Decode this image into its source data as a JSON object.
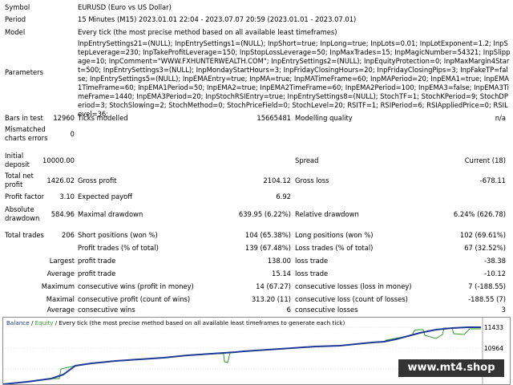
{
  "symbol": {
    "label": "Symbol",
    "value": "EURUSD (Euro vs US Dollar)"
  },
  "period": {
    "label": "Period",
    "value": "15 Minutes (M15) 2023.01.01 22:04 - 2023.07.07 20:59 (2023.01.01 - 2023.07.01)"
  },
  "model": {
    "label": "Model",
    "value": "Every tick (the most precise method based on all available least timeframes)"
  },
  "parameters": {
    "label": "Parameters",
    "value": "InpEntrySettings21=(NULL); InpEntrySettings1=(NULL); InpShort=true; InpLong=true; InpLots=0.01; InpLotExponent=1.2; InpStepLeverage=230; InpTakeProfitLeverage=150; InpStopLossLeverage=50; InpMaxTrades=15; InpMagicNumber=54321; InpSlippage=10; InpComment=\"WWW.FXHUNTERWEALTH.COM\"; InpEntrySettings2=(NULL); InpEquityProtection=0; InpMaxMargin4Start=500; InpEntrySettings3=(NULL); InpMondayStartHours=3; InpFridayClosingHours=20; InpFridayClosingPips=3; InpFakeTP=false; InpEntrySettings5=(NULL); InpEMAEntry=true; InpMA=true; InpMATimeFrame=60; InpMAPeriod=20; InpEMA1=true; InpEMA1TimeFrame=60; InpEMA1Period=50; InpEMA2=true; InpEMA2TimeFrame=60; InpEMA2Period=100; InpEMA3=false; InpEMA3TimeFrame=1440; InpEMA3Period=20; InpStochRSIEntry=true; InpEntrySettings8=(NULL); StochTF=1; StochKPeriod=9; StochDPeriod=3; StochSlowing=2; StochMethod=0; StochPriceField=0; StochLevel=20; RSITF=1; RSIPeriod=6; RSIAppliedPrice=0; RSILevel=36;"
  },
  "bars": {
    "label": "Bars in test",
    "value": "12960",
    "ticks_label": "Ticks modelled",
    "ticks_value": "15665481",
    "quality_label": "Modelling quality",
    "quality_value": "n/a"
  },
  "mismatched": {
    "label1": "Mismatched",
    "label2": "charts errors",
    "value": "0"
  },
  "deposit": {
    "label1": "Initial",
    "label2": "deposit",
    "value": "10000.00",
    "spread_label": "Spread",
    "spread_value": "Current (18)"
  },
  "net": {
    "label1": "Total net",
    "label2": "profit",
    "value": "1426.02",
    "gp_label": "Gross profit",
    "gp_value": "2104.12",
    "gl_label": "Gross loss",
    "gl_value": "-678.11"
  },
  "pf": {
    "label": "Profit factor",
    "value": "3.10",
    "ep_label": "Expected payoff",
    "ep_value": "6.92"
  },
  "dd": {
    "label1": "Absolute",
    "label2": "drawdown",
    "value": "584.96",
    "max_label": "Maximal drawdown",
    "max_value": "639.95 (6.22%)",
    "rel_label": "Relative drawdown",
    "rel_value": "6.24% (626.78)"
  },
  "trades": {
    "label": "Total trades",
    "value": "206",
    "short_label": "Short positions (won %)",
    "short_value": "104 (65.38%)",
    "long_label": "Long positions (won %)",
    "long_value": "102 (69.61%)"
  },
  "profit_trades": {
    "label": "Profit trades (% of total)",
    "value": "139 (67.48%)",
    "loss_label": "Loss trades (% of total)",
    "loss_value": "67 (32.52%)"
  },
  "largest": {
    "prefix": "Largest",
    "label": "profit trade",
    "value": "138.00",
    "loss_label": "loss trade",
    "loss_value": "-38.38"
  },
  "average": {
    "prefix": "Average",
    "label": "profit trade",
    "value": "15.14",
    "loss_label": "loss trade",
    "loss_value": "-10.12"
  },
  "max_consec": {
    "prefix": "Maximum",
    "label": "consecutive wins (profit in money)",
    "value": "14 (67.27)",
    "loss_label": "consecutive losses (loss in money)",
    "loss_value": "7 (-188.55)"
  },
  "maximal": {
    "prefix": "Maximal",
    "label": "consecutive profit (count of wins)",
    "value": "313.20 (11)",
    "loss_label": "consecutive loss (count of losses)",
    "loss_value": "-188.55 (7)"
  },
  "avg_consec": {
    "prefix": "Average",
    "label": "consecutive wins",
    "value": "6",
    "loss_label": "consecutive losses",
    "loss_value": "3"
  },
  "graph": {
    "legend_balance": "Balance",
    "legend_sep": " / ",
    "legend_equity": "Equity",
    "legend_rest": " / Every tick (the most precise method based on all available least timeframes to generate each tick)",
    "ylabels": [
      "11433",
      "10964"
    ],
    "balance_color": "#1f3a93",
    "equity_color": "#2e9a2e"
  },
  "watermark": "www.mt4.shop"
}
